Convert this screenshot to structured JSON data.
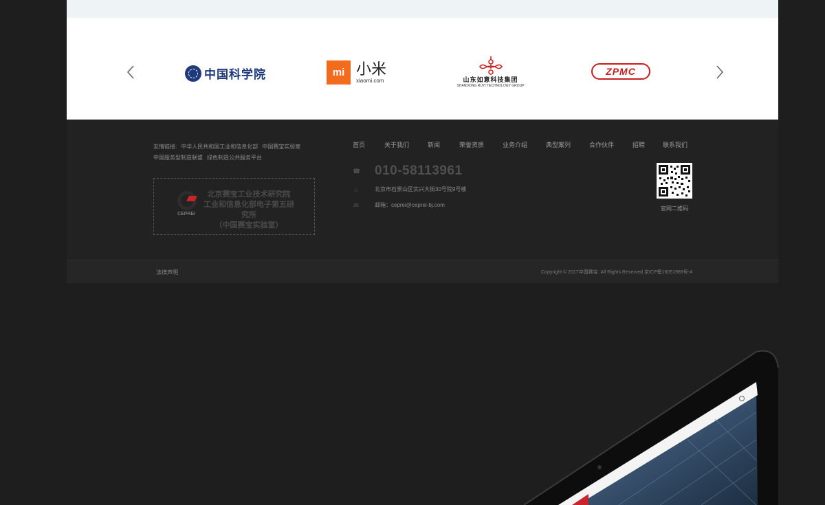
{
  "partners": {
    "prev_icon": "chevron-left-icon",
    "next_icon": "chevron-right-icon",
    "logos": {
      "cas": "中国科学院",
      "xiaomi_cn": "小米",
      "xiaomi_box": "mi",
      "xiaomi_en": "xiaomi.com",
      "ruyi_cn": "山东如意科技集团",
      "ruyi_en": "SHANDONG RUYI TECHNOLOGY GROUP",
      "zpmc": "ZPMC"
    }
  },
  "footer": {
    "friend_links_label": "友情链接:",
    "friend_links": [
      "中华人民共和国工业和信息化部",
      "中国赛宝实验室",
      "中国服务型制造联盟",
      "绿色制造公共服务平台"
    ],
    "ceprei": {
      "line1": "北京赛宝工业技术研究院",
      "line2": "工业和信息化部电子第五研究所",
      "line3": "（中国赛宝实验室）",
      "abbr": "CEPREI"
    },
    "nav": [
      "首页",
      "关于我们",
      "新闻",
      "荣誉资质",
      "业务介绍",
      "典型案列",
      "合作伙伴",
      "招聘",
      "联系我们"
    ],
    "phone": "010-58113961",
    "address": "北京市石景山区实兴大街30号院9号楼",
    "email": "邮箱：ceprei@ceprei-bj.com",
    "qr_caption": "官网二维码",
    "icons": {
      "phone": "phone-icon",
      "address": "location-icon",
      "email": "mail-icon"
    }
  },
  "bottom": {
    "legal": "法律声明",
    "copyright": "Copyright © 2017中国赛宝. All Rights Reserved 京ICP备16051989号-4"
  },
  "colors": {
    "background": "#1e1e1e",
    "footer": "#222222",
    "xiaomi_orange": "#f36c1e",
    "cas_blue": "#1f3a7a",
    "ruyi_red": "#c61d1d",
    "zpmc_red": "#c61d1d"
  }
}
